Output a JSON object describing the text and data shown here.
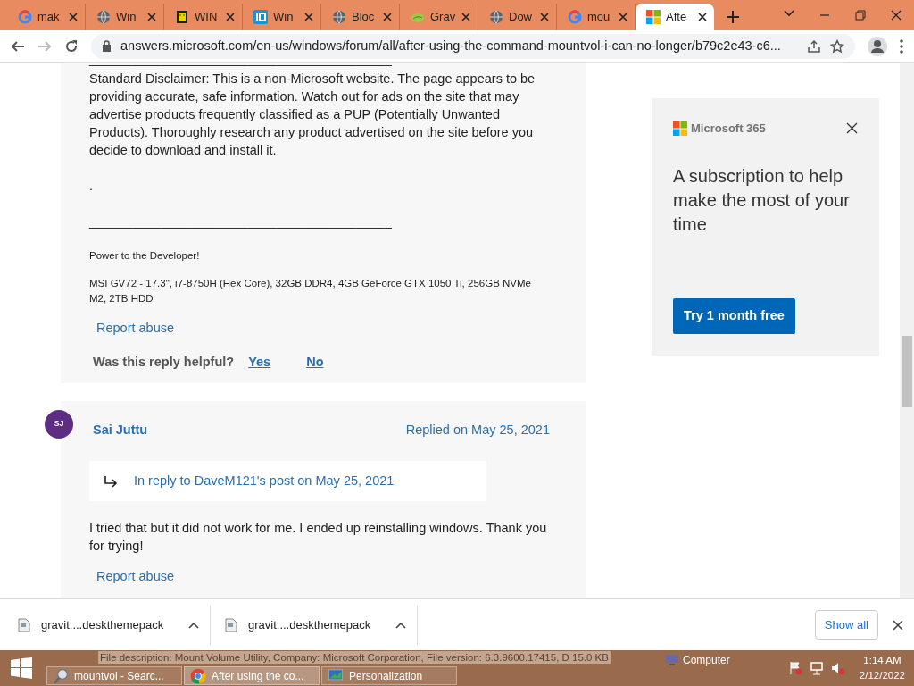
{
  "browser": {
    "tabs": [
      {
        "label": "mak",
        "kind": "google",
        "selected": false
      },
      {
        "label": "Win",
        "kind": "globe",
        "selected": false
      },
      {
        "label": "WIN",
        "kind": "pixel",
        "selected": false
      },
      {
        "label": "Win",
        "kind": "tile",
        "selected": false
      },
      {
        "label": "Bloc",
        "kind": "globe",
        "selected": false
      },
      {
        "label": "Grav",
        "kind": "leaf",
        "selected": false
      },
      {
        "label": "Dow",
        "kind": "globe",
        "selected": false
      },
      {
        "label": "mou",
        "kind": "google",
        "selected": false
      },
      {
        "label": "Afte",
        "kind": "windows",
        "selected": true
      }
    ],
    "address": "answers.microsoft.com/en-us/windows/forum/all/after-using-the-command-mountvol-i-can-no-longer/b79c2e43-c6..."
  },
  "post_1": {
    "blocks": [
      {
        "kind": "body",
        "text": "__________________________________________"
      },
      {
        "kind": "body",
        "text": "Standard Disclaimer: This is a non-Microsoft website. The page appears to be providing accurate, safe information. Watch out for ads on the site that may advertise products frequently classified as a PUP (Potentially Unwanted Products). Thoroughly research any product advertised on the site before you decide to download and install it."
      },
      {
        "kind": "body",
        "text": "."
      },
      {
        "kind": "body",
        "text": "__________________________________________"
      },
      {
        "kind": "signature",
        "text": "Power to the Developer!"
      },
      {
        "kind": "signature",
        "text": "MSI GV72 - 17.3\", i7-8750H (Hex Core), 32GB DDR4, 4GB GeForce GTX 1050 Ti, 256GB NVMe M2, 2TB HDD"
      }
    ],
    "report": "Report abuse",
    "helpful": {
      "question": "Was this reply helpful?",
      "yes": "Yes",
      "no": "No"
    }
  },
  "post_2": {
    "initials": "SJ",
    "author": "Sai Juttu",
    "date": "Replied on May 25, 2021",
    "in_reply": "In reply to DaveM121's post on May 25, 2021",
    "body": "I tried that but it did not work for me. I ended up reinstalling windows. Thank you for trying!",
    "report": "Report abuse"
  },
  "ad": {
    "brand": "Microsoft 365",
    "headline": "A subscription to help make the most of your time",
    "button": "Try 1 month free"
  },
  "downloads": [
    {
      "name": "gravit....deskthemepack"
    },
    {
      "name": "gravit....deskthemepack"
    }
  ],
  "show_all": "Show all",
  "taskbar": {
    "tooltip": "File description: Mount Volume Utility, Company: Microsoft Corporation, File version: 6.3.9600.17415, D 15.0 KB",
    "tasks": [
      {
        "label": "mountvol - Searc...",
        "kind": "search",
        "selected": false
      },
      {
        "label": "After using the co...",
        "kind": "chrome",
        "selected": true
      },
      {
        "label": "Personalization",
        "kind": "monitor",
        "selected": false
      }
    ],
    "desktop_item": "Computer",
    "time": "1:14 AM",
    "date": "2/12/2022"
  }
}
